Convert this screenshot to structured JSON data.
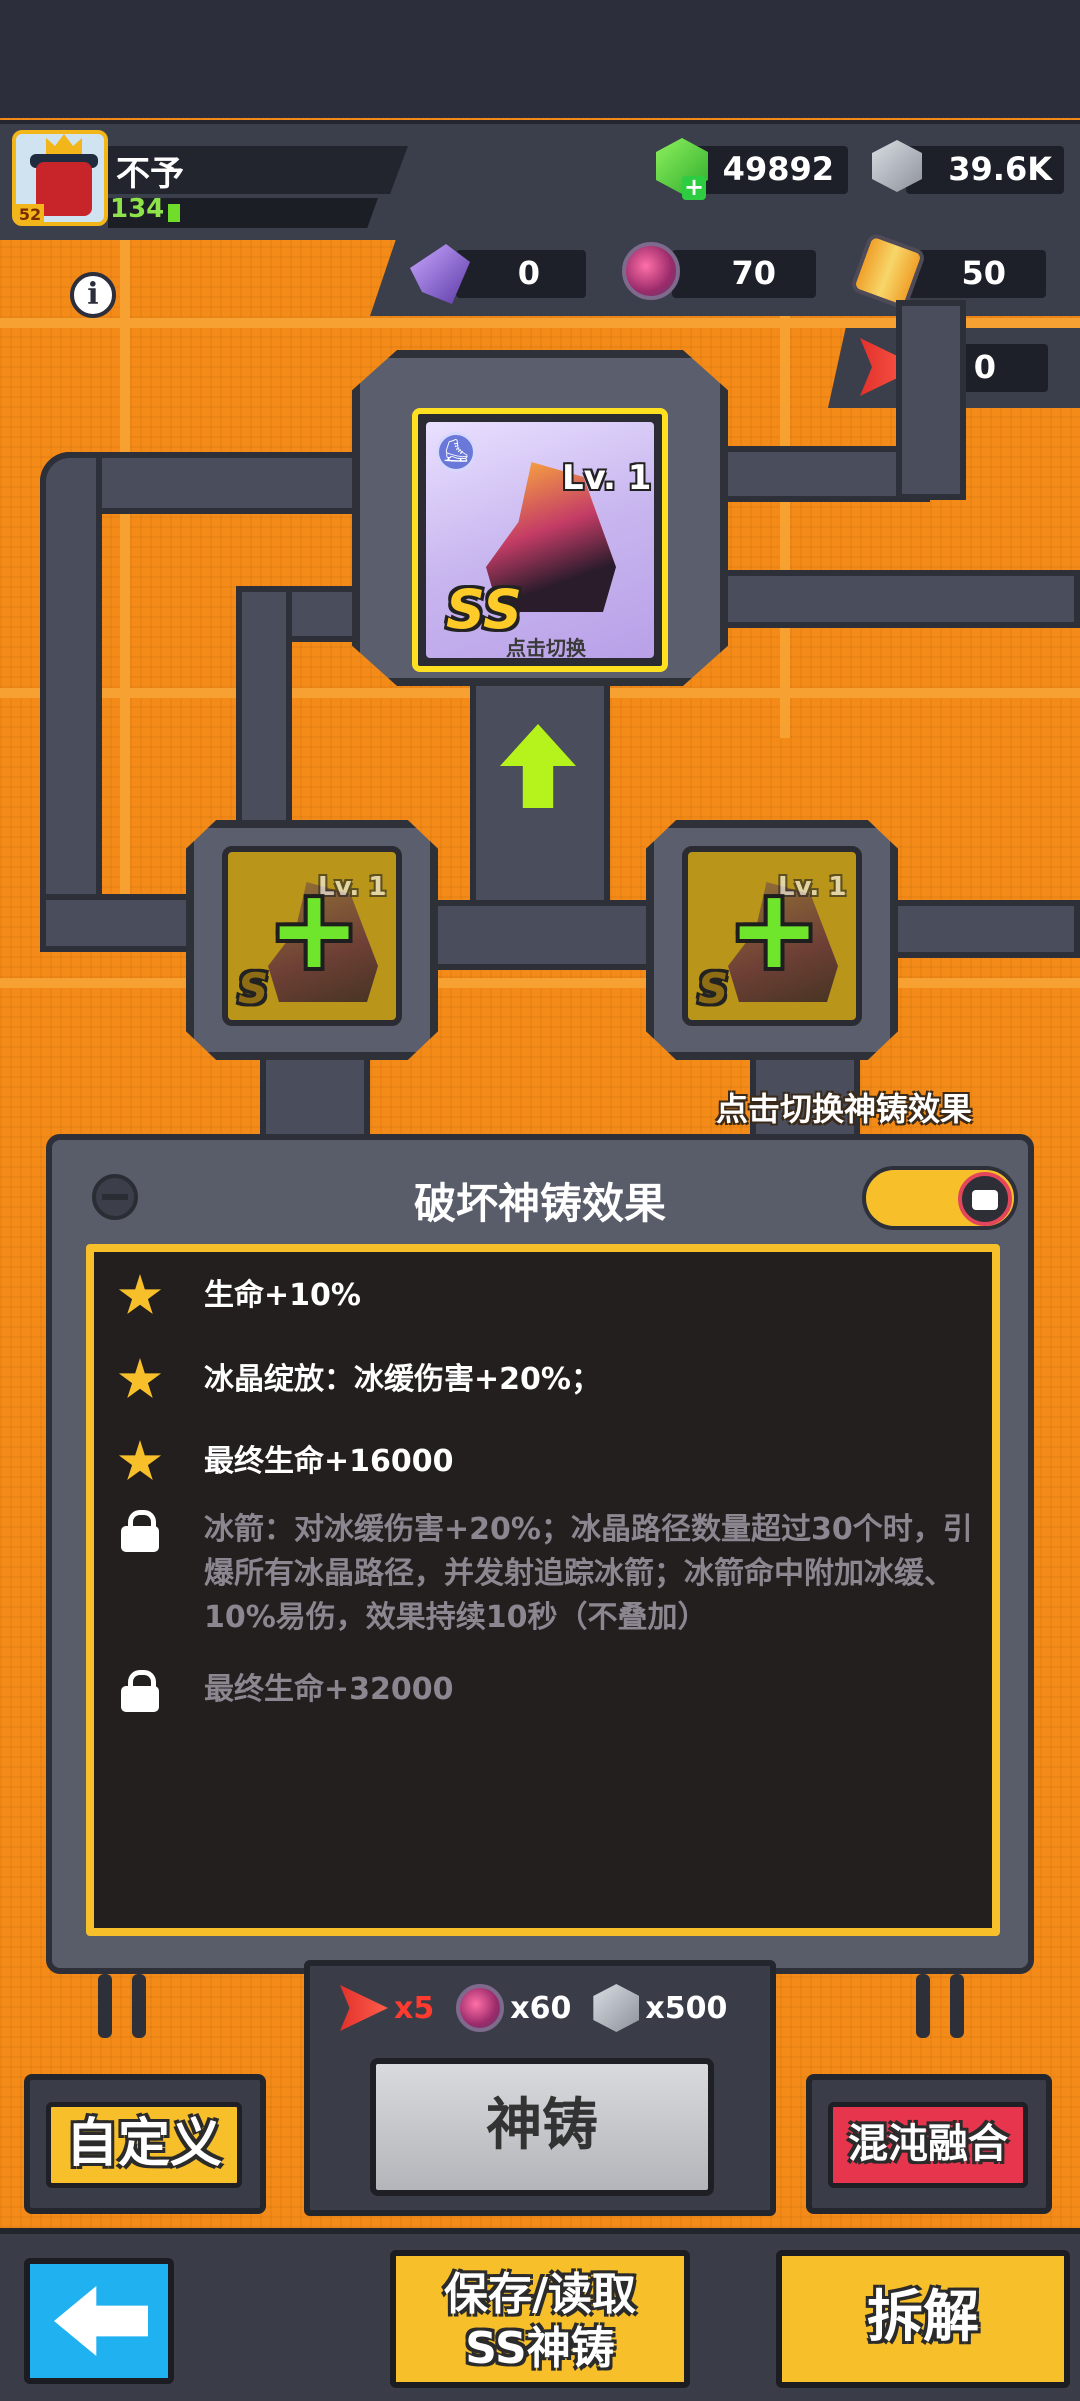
{
  "player": {
    "name": "不予",
    "level": "134",
    "avatar_level": "52"
  },
  "resources": {
    "gems": "49892",
    "cubes": "39.6K",
    "shards": "0",
    "orbs": "70",
    "scrolls": "50",
    "tickets": "0"
  },
  "main_item": {
    "level": "Lv. 1",
    "grade": "SS",
    "tap_hint": "点击切换"
  },
  "side_items": [
    {
      "level": "Lv. 1",
      "grade": "S"
    },
    {
      "level": "Lv. 1",
      "grade": "S"
    }
  ],
  "switch_hint": "点击切换神铸效果",
  "panel": {
    "title": "破坏神铸效果",
    "effects": [
      {
        "text": "生命+10%",
        "unlocked": true
      },
      {
        "text": "冰晶绽放：冰缓伤害+20%；",
        "unlocked": true
      },
      {
        "text": "最终生命+16000",
        "unlocked": true
      },
      {
        "text": "冰箭：对冰缓伤害+20%；冰晶路径数量超过30个时，引爆所有冰晶路径，并发射追踪冰箭；冰箭命中附加冰缓、10%易伤，效果持续10秒（不叠加）",
        "unlocked": false
      },
      {
        "text": "最终生命+32000",
        "unlocked": false
      }
    ]
  },
  "cost": {
    "ticket": "x5",
    "orb": "x60",
    "cube": "x500"
  },
  "buttons": {
    "forge": "神铸",
    "custom": "自定义",
    "chaos_fusion": "混沌融合",
    "save_load_line1": "保存/读取",
    "save_load_line2": "SS神铸",
    "disassemble": "拆解"
  },
  "colors": {
    "background_orange": "#f48a17",
    "accent_yellow": "#f7c02a",
    "chaos_red": "#e8354e",
    "back_blue": "#1fb1f0",
    "locked_text": "#8a8790"
  },
  "icons": [
    "info-icon",
    "gem-icon",
    "cube-icon",
    "shard-icon",
    "orb-icon",
    "scroll-icon",
    "ticket-icon",
    "star-icon",
    "lock-icon",
    "back-arrow-icon",
    "up-arrow-icon",
    "plus-icon"
  ]
}
